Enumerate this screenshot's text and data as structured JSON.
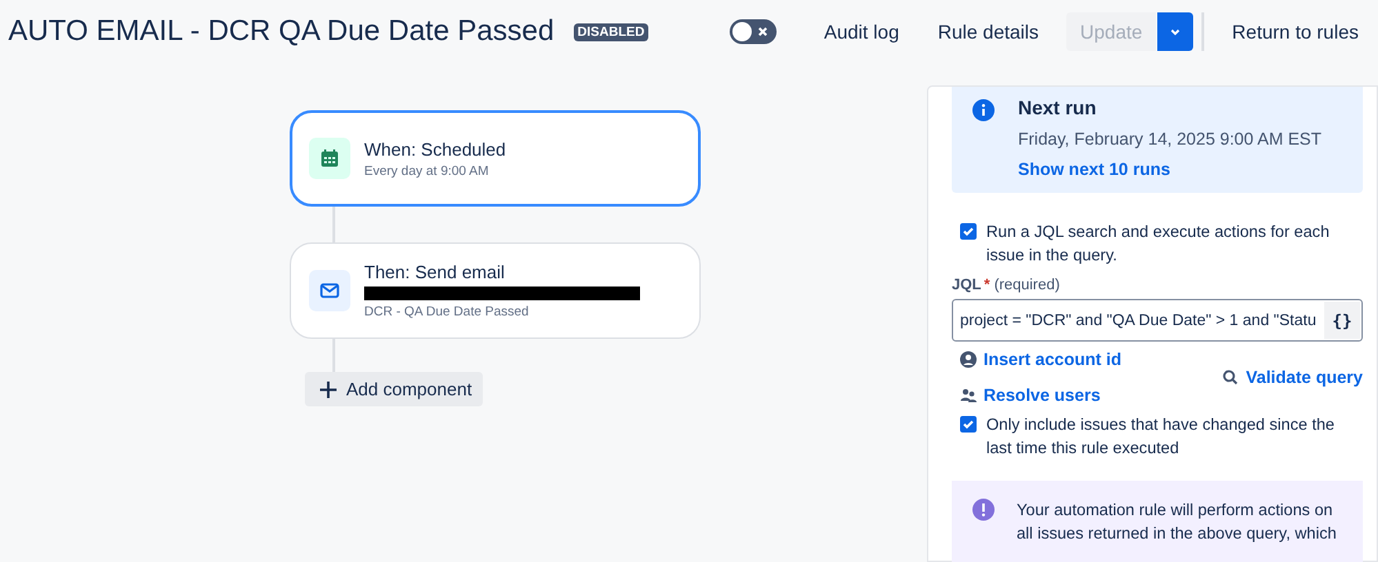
{
  "header": {
    "title": "AUTO EMAIL - DCR QA Due Date Passed",
    "status_badge": "DISABLED",
    "rule_enabled": false,
    "buttons": [
      {
        "label": "Audit log",
        "kind": "link"
      },
      {
        "label": "Rule details",
        "kind": "link"
      },
      {
        "label": "Update",
        "kind": "split",
        "disabled": true
      },
      {
        "label": "Return to rules",
        "kind": "link"
      }
    ]
  },
  "flow": {
    "components": [
      {
        "kind": "trigger",
        "title": "When: Scheduled",
        "subtitle": "Every day at 9:00 AM",
        "selected": true,
        "redacted": false
      },
      {
        "kind": "action",
        "title": "Then: Send email",
        "subtitle": "DCR - QA Due Date Passed",
        "selected": false,
        "redacted": true
      }
    ],
    "add_button": "Add component"
  },
  "panel": {
    "next_run": {
      "title": "Next run",
      "date": "Friday, February 14, 2025 9:00 AM EST",
      "link": "Show next 10 runs"
    },
    "jql_search": {
      "checked": true,
      "label": "Run a JQL search and execute actions for each issue in the query."
    },
    "jql": {
      "label": "JQL",
      "required_mark": "*",
      "required_hint": "(required)",
      "value": "project = \"DCR\" and \"QA Due Date\" > 1 and \"Statu",
      "brace_button": "{}"
    },
    "links": {
      "insert": "Insert account id",
      "resolve": "Resolve users",
      "validate": "Validate query"
    },
    "only_changed": {
      "checked": true,
      "label": "Only include issues that have changed since the last time this rule executed"
    },
    "warning": "Your automation rule will perform actions on all issues returned in the above query, which"
  }
}
